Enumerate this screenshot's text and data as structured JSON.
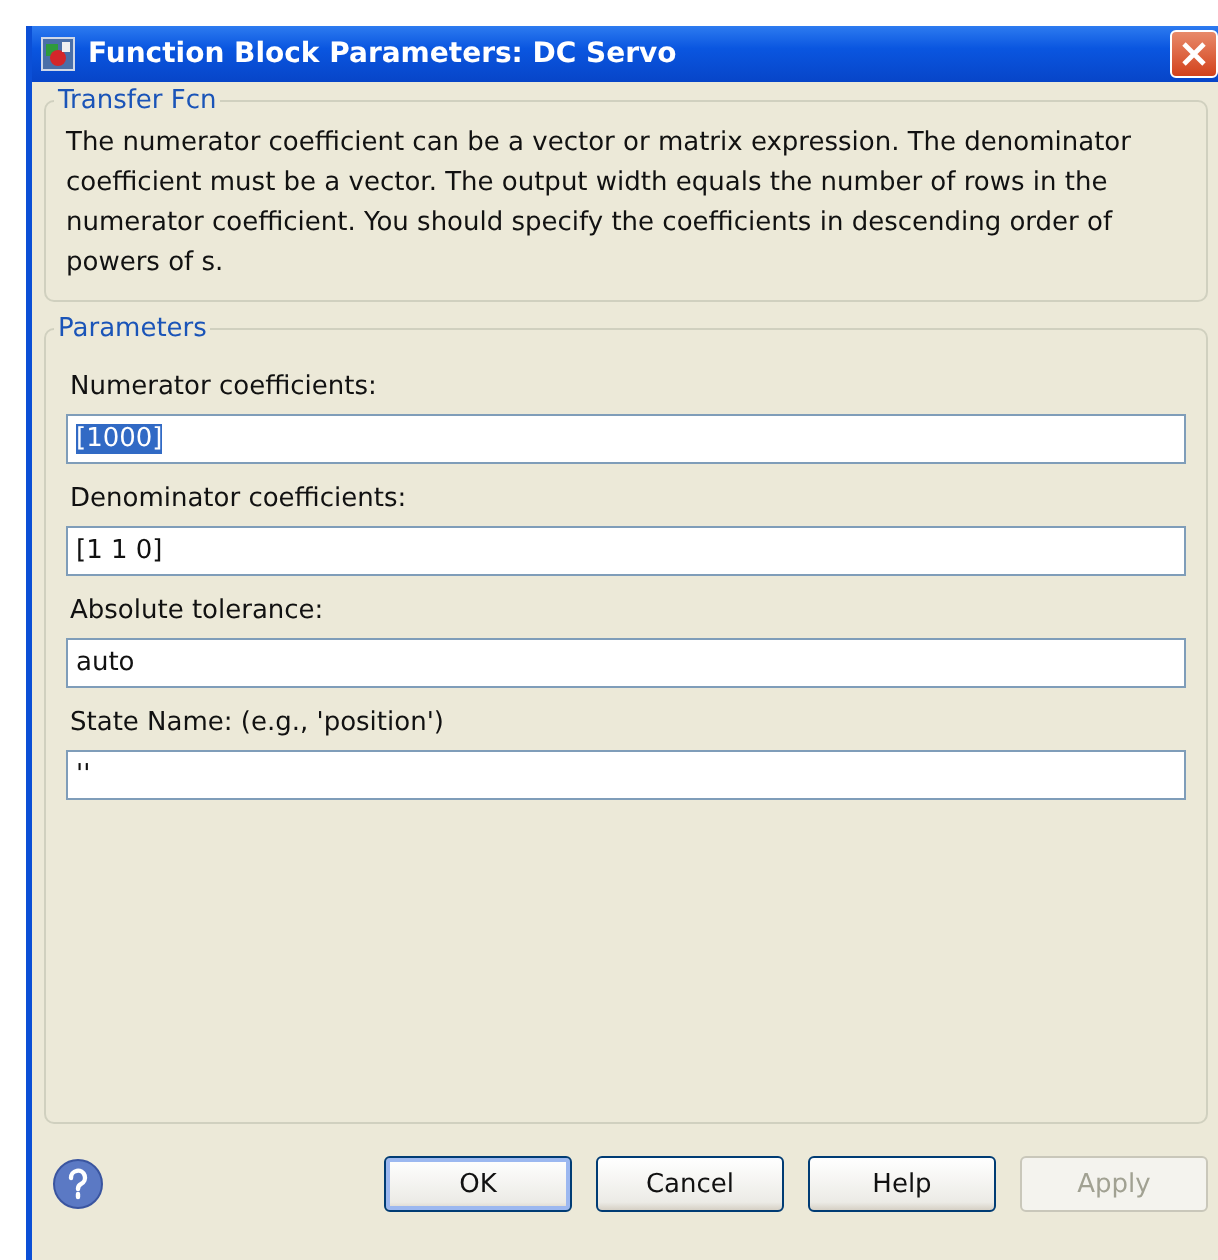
{
  "window": {
    "title": "Function Block Parameters: DC Servo"
  },
  "description_group": {
    "title": "Transfer Fcn",
    "text": "The numerator coefficient can be a vector or matrix expression. The denominator coefficient must be a vector. The output width equals the number of rows in the numerator coefficient. You should specify the coefficients in descending order of powers of s."
  },
  "parameters_group": {
    "title": "Parameters",
    "fields": [
      {
        "label": "Numerator coefficients:",
        "value": "[1000]",
        "text_selected": true
      },
      {
        "label": "Denominator coefficients:",
        "value": "[1 1 0]",
        "text_selected": false
      },
      {
        "label": "Absolute tolerance:",
        "value": "auto",
        "text_selected": false
      },
      {
        "label": "State Name: (e.g., 'position')",
        "value": "''",
        "text_selected": false
      }
    ]
  },
  "buttons": [
    {
      "label": "OK",
      "disabled": false,
      "default": true
    },
    {
      "label": "Cancel",
      "disabled": false,
      "default": false
    },
    {
      "label": "Help",
      "disabled": false,
      "default": false
    },
    {
      "label": "Apply",
      "disabled": true,
      "default": false
    }
  ]
}
